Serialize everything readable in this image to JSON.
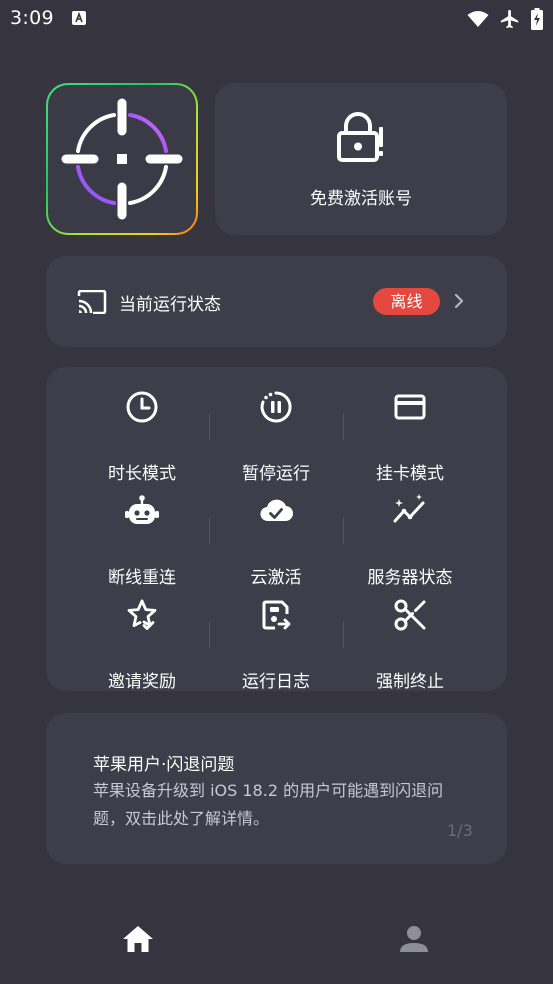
{
  "status_bar": {
    "time": "3:09"
  },
  "activate": {
    "label": "免费激活账号"
  },
  "run_status": {
    "label": "当前运行状态",
    "badge": "离线",
    "badge_color": "#e5483e"
  },
  "actions": [
    {
      "label": "时长模式",
      "icon": "clock-icon"
    },
    {
      "label": "暂停运行",
      "icon": "pause-icon"
    },
    {
      "label": "挂卡模式",
      "icon": "card-icon"
    },
    {
      "label": "断线重连",
      "icon": "robot-icon"
    },
    {
      "label": "云激活",
      "icon": "cloud-check-icon"
    },
    {
      "label": "服务器状态",
      "icon": "trend-sparkle-icon"
    },
    {
      "label": "邀请奖励",
      "icon": "star-check-icon"
    },
    {
      "label": "运行日志",
      "icon": "log-export-icon"
    },
    {
      "label": "强制终止",
      "icon": "scissors-icon"
    }
  ],
  "notice": {
    "title": "苹果用户·闪退问题",
    "body": "苹果设备升级到 iOS 18.2 的用户可能遇到闪退问题，双击此处了解详情。",
    "page": "1/3"
  },
  "colors": {
    "background": "#35343f",
    "card": "#3e3d4a",
    "accent_purple": "#8b5cf6"
  }
}
